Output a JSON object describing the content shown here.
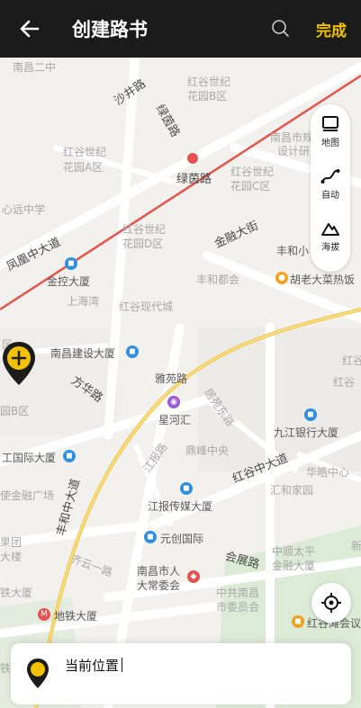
{
  "header": {
    "title": "创建路书",
    "done_label": "完成"
  },
  "side_panel": {
    "map_label": "地图",
    "auto_label": "自动",
    "altitude_label": "海拔"
  },
  "bottom": {
    "location_text": "当前位置"
  },
  "map": {
    "labels": [
      {
        "text": "南昌二中"
      },
      {
        "text": "沙井路"
      },
      {
        "text": "红谷世纪"
      },
      {
        "text": "花园B区"
      },
      {
        "text": "绿茵路"
      },
      {
        "text": "绿茵路"
      },
      {
        "text": "红谷世纪"
      },
      {
        "text": "花园A区"
      },
      {
        "text": "南昌市规划"
      },
      {
        "text": "设计研究"
      },
      {
        "text": "红谷世纪"
      },
      {
        "text": "花园C区"
      },
      {
        "text": "心远中学"
      },
      {
        "text": "红谷世纪"
      },
      {
        "text": "花园D区"
      },
      {
        "text": "金融大街"
      },
      {
        "text": "丰和小"
      },
      {
        "text": "凤凰中大道"
      },
      {
        "text": "金控大厦"
      },
      {
        "text": "丰和都会"
      },
      {
        "text": "胡老大菜热饭"
      },
      {
        "text": "上海湾"
      },
      {
        "text": "红谷现代城"
      },
      {
        "text": "区"
      },
      {
        "text": "南昌建设大厦"
      },
      {
        "text": "雅苑路"
      },
      {
        "text": "红谷"
      },
      {
        "text": "方华路"
      },
      {
        "text": "红谷"
      },
      {
        "text": "星河汇"
      },
      {
        "text": "居苑东路"
      },
      {
        "text": "园B区"
      },
      {
        "text": "九江银行大厦"
      },
      {
        "text": "江报路"
      },
      {
        "text": "鼎峰中央"
      },
      {
        "text": "红谷中大道"
      },
      {
        "text": "工国际大厦"
      },
      {
        "text": "华皓中心"
      },
      {
        "text": "使金融广场"
      },
      {
        "text": "丰和中大道"
      },
      {
        "text": "江报传媒大厦"
      },
      {
        "text": "汇和家园"
      },
      {
        "text": "果团"
      },
      {
        "text": "大楼"
      },
      {
        "text": "元创国际"
      },
      {
        "text": "齐云一路"
      },
      {
        "text": "会展路"
      },
      {
        "text": "中顺太平"
      },
      {
        "text": "金融大厦"
      },
      {
        "text": "新"
      },
      {
        "text": "南昌市人"
      },
      {
        "text": "大常委会"
      },
      {
        "text": "铁大厦"
      },
      {
        "text": "中共南昌"
      },
      {
        "text": "市委员会"
      },
      {
        "text": "地铁大厦"
      },
      {
        "text": "红谷滩会议"
      },
      {
        "text": "铁"
      }
    ]
  }
}
